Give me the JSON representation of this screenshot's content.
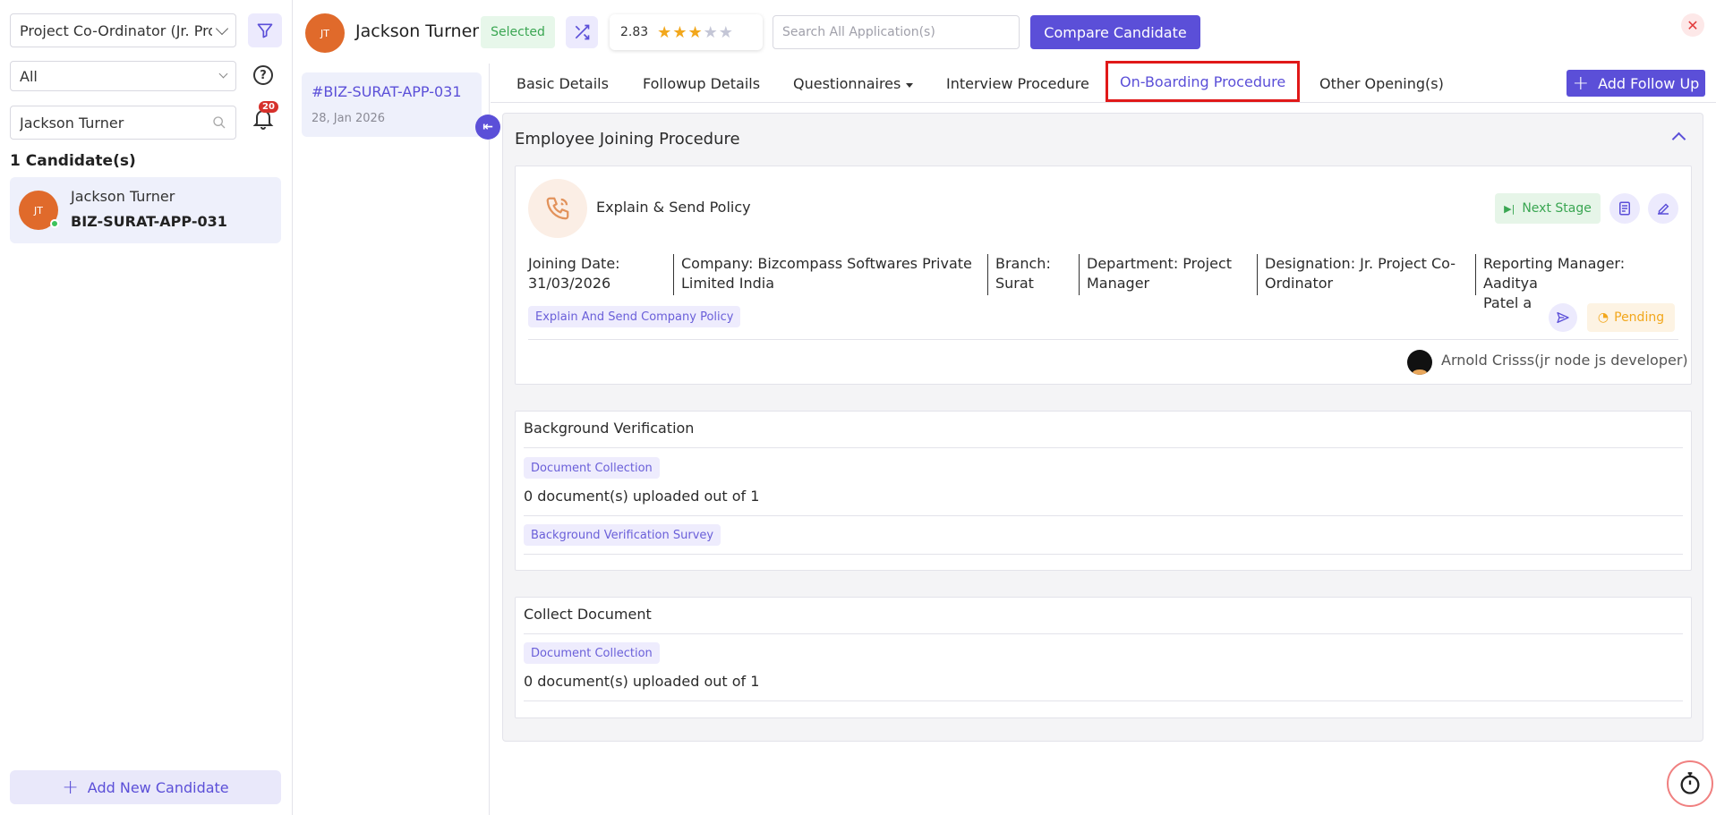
{
  "sidebar": {
    "job_select": "Project Co-Ordinator (Jr. Pro",
    "status_select": "All",
    "search_value": "Jackson Turner",
    "notifications_count": "20",
    "candidates_count": "1 Candidate(s)",
    "candidates": [
      {
        "initials": "JT",
        "name": "Jackson Turner",
        "code": "BIZ-SURAT-APP-031"
      }
    ],
    "add_candidate_label": "Add New Candidate"
  },
  "header": {
    "initials": "JT",
    "candidate_name": "Jackson Turner",
    "status_badge": "Selected",
    "rating_value": "2.83",
    "rating_stars": 3,
    "rating_max": 5,
    "search_placeholder": "Search All Application(s)",
    "compare_label": "Compare Candidate",
    "close_icon": "close-icon"
  },
  "applications": [
    {
      "code": "#BIZ-SURAT-APP-031",
      "date": "28, Jan 2026"
    }
  ],
  "tabs": [
    {
      "label": "Basic Details"
    },
    {
      "label": "Followup Details"
    },
    {
      "label": "Questionnaires"
    },
    {
      "label": "Interview Procedure"
    },
    {
      "label": "On-Boarding Procedure",
      "active": true
    },
    {
      "label": "Other Opening(s)"
    }
  ],
  "add_follow_up_label": "Add Follow Up",
  "onboarding": {
    "section_title": "Employee Joining Procedure",
    "stage": {
      "title": "Explain & Send Policy",
      "next_stage_label": "Next Stage",
      "info": {
        "joining_date": [
          "Joining Date:",
          "31/03/2026"
        ],
        "company": [
          "Company: Bizcompass Softwares Private",
          "Limited India"
        ],
        "branch": [
          "Branch:",
          "Surat"
        ],
        "department": [
          "Department: Project",
          "Manager"
        ],
        "designation": [
          "Designation: Jr. Project Co-",
          "Ordinator"
        ],
        "reporting_manager": [
          "Reporting Manager: Aaditya",
          "Patel a"
        ]
      },
      "task_tag": "Explain And Send Company Policy",
      "status": "Pending",
      "assignee": "Arnold Crisss(jr node js developer)"
    },
    "background_verification": {
      "title": "Background Verification",
      "doc_tag": "Document Collection",
      "doc_count": "0 document(s) uploaded out of 1",
      "survey_tag": "Background Verification Survey"
    },
    "collect_document": {
      "title": "Collect Document",
      "doc_tag": "Document Collection",
      "doc_count": "0 document(s) uploaded out of 1"
    }
  },
  "colors": {
    "accent": "#5b4fd8",
    "success": "#3aa652",
    "warning": "#f2a71c",
    "danger": "#e01919",
    "avatar": "#e06a2b"
  }
}
